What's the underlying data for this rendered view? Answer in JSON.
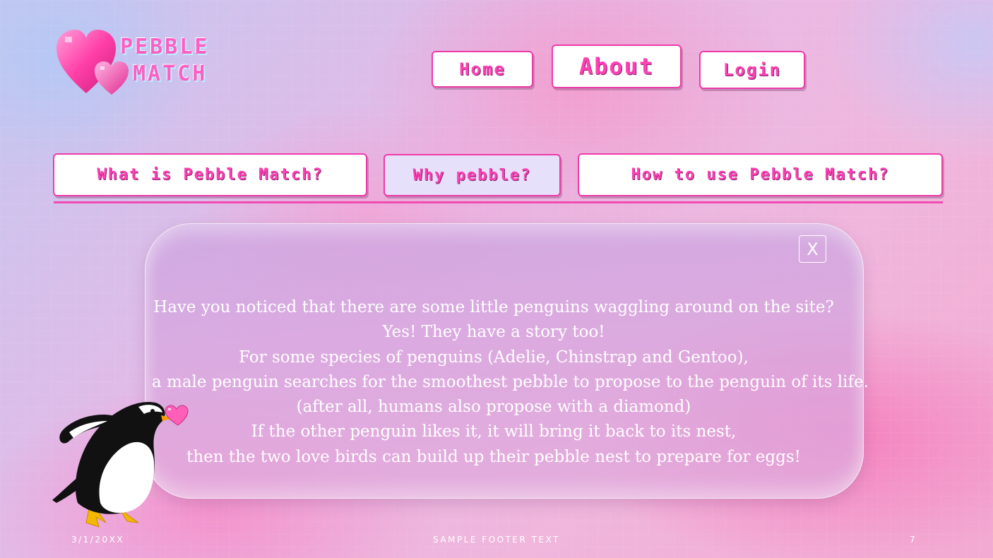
{
  "logo": {
    "line1": "Pebble",
    "line2": "Match",
    "icon": "hearts-icon"
  },
  "nav": {
    "home": "Home",
    "about": "About",
    "login": "Login"
  },
  "tabs": [
    {
      "label": "What is Pebble Match?"
    },
    {
      "label": "Why pebble?",
      "active": true
    },
    {
      "label": "How to use Pebble Match?"
    }
  ],
  "dialog": {
    "close_label": "X",
    "lines": [
      "Have you noticed that there are some little penguins waggling around on the site?",
      "Yes!  They have a story too!",
      "For some species of penguins (Adelie, Chinstrap and Gentoo),",
      "a male penguin searches for the smoothest pebble to propose to the penguin of its life.",
      "(after all, humans also propose with a diamond)",
      "If the other penguin likes it, it will bring it back to its nest,",
      "then the two love birds can build up their pebble nest to prepare for eggs!"
    ]
  },
  "footer": {
    "date": "3/1/20XX",
    "text": "Sample Footer Text",
    "page": "7"
  },
  "colors": {
    "accent": "#ee3aa7",
    "button_text": "#ff3fb4",
    "panel": "#d4a5dc"
  }
}
